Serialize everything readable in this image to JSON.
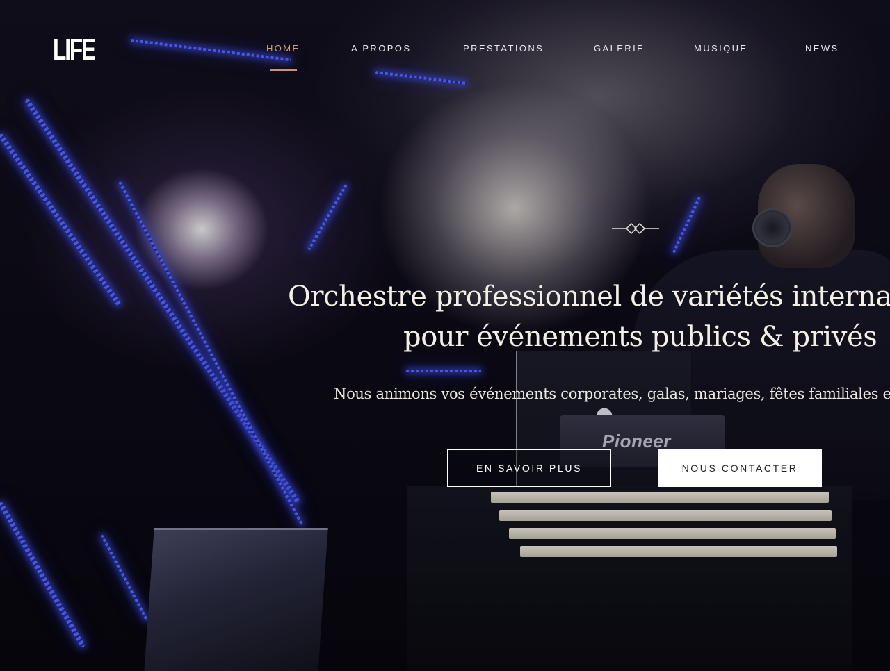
{
  "brand": {
    "logo_text": "LIFE"
  },
  "nav": {
    "items": [
      {
        "label": "HOME",
        "active": true
      },
      {
        "label": "A PROPOS",
        "active": false
      },
      {
        "label": "PRESTATIONS",
        "active": false
      },
      {
        "label": "GALERIE",
        "active": false
      },
      {
        "label": "MUSIQUE",
        "active": false
      },
      {
        "label": "NEWS",
        "active": false
      }
    ],
    "active_color": "#cfa07c"
  },
  "hero": {
    "headline_line1": "Orchestre professionnel de variétés internati",
    "headline_line2": "pour événements publics & privés",
    "subtitle": "Nous animons vos événements corporates, galas, mariages, fêtes familiales et",
    "buttons": {
      "learn_more": "EN SAVOIR PLUS",
      "contact": "NOUS CONTACTER"
    },
    "divider_icon": "diamond-ornament-icon"
  },
  "background": {
    "equipment_brand": "Pioneer",
    "laptop_logo": "apple-logo-icon"
  }
}
